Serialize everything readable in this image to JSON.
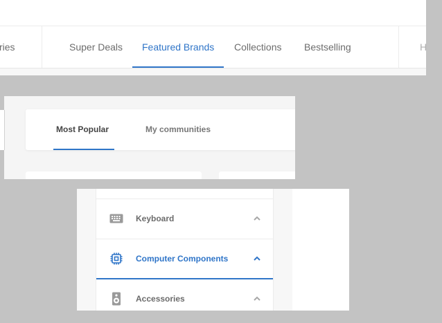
{
  "nav": {
    "items": [
      {
        "label": "ries"
      },
      {
        "label": "Super Deals"
      },
      {
        "label": "Featured Brands"
      },
      {
        "label": "Collections"
      },
      {
        "label": "Bestselling"
      },
      {
        "label": "H"
      }
    ],
    "active_index": 2
  },
  "community": {
    "tabs": [
      {
        "label": "Most Popular"
      },
      {
        "label": "My communities"
      }
    ],
    "active_index": 0
  },
  "categories": {
    "items": [
      {
        "label": "Keyboard",
        "icon": "keyboard-icon"
      },
      {
        "label": "Computer Components",
        "icon": "chip-icon"
      },
      {
        "label": "Accessories",
        "icon": "speaker-icon"
      }
    ],
    "active_index": 1
  },
  "colors": {
    "accent": "#2f75c8",
    "text": "#6c6c6c",
    "background": "#c3c3c3",
    "icon": "#9a9a9a"
  }
}
